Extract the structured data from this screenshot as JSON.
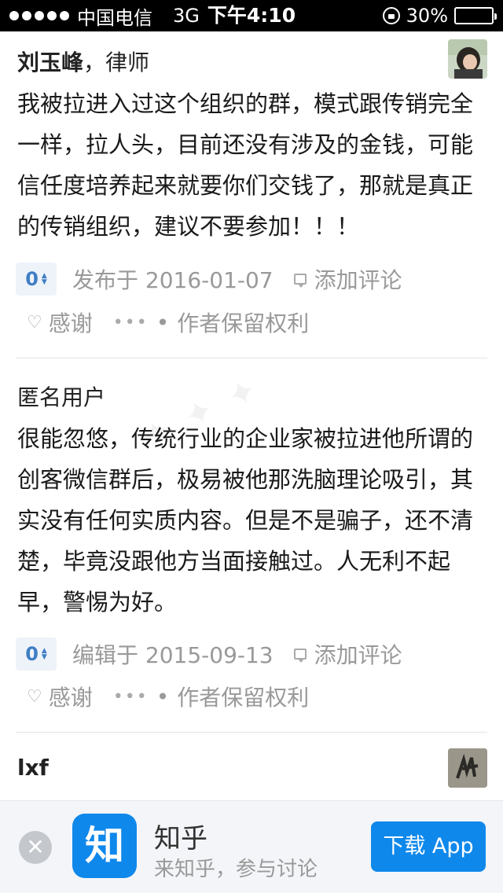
{
  "status_bar": {
    "carrier": "中国电信",
    "network": "3G",
    "time": "下午4:10",
    "battery_text": "30%",
    "battery_level": 0.3
  },
  "answers": [
    {
      "author_name": "刘玉峰",
      "author_title": "，律师",
      "content": "我被拉进入过这个组织的群，模式跟传销完全一样，拉人头，目前还没有涉及的金钱，可能信任度培养起来就要你们交钱了，那就是真正的传销组织，建议不要参加！！！",
      "votes": "0",
      "date_text": "发布于 2016-01-07",
      "comment_label": "添加评论",
      "thanks_label": "感谢",
      "more_label": "•••",
      "rights_label": "作者保留权利"
    },
    {
      "author_name": "匿名用户",
      "author_title": "",
      "content": "很能忽悠，传统行业的企业家被拉进他所谓的创客微信群后，极易被他那洗脑理论吸引，其实没有任何实质内容。但是不是骗子，还不清楚，毕竟没跟他方当面接触过。人无利不起早，警惕为好。",
      "votes": "0",
      "date_text": "编辑于 2015-09-13",
      "comment_label": "添加评论",
      "thanks_label": "感谢",
      "more_label": "•••",
      "rights_label": "作者保留权利"
    },
    {
      "author_name": "lxf",
      "author_title": ""
    }
  ],
  "banner": {
    "close_icon": "✕",
    "app_icon_text": "知",
    "app_name": "知乎",
    "app_subtitle": "来知乎，参与讨论",
    "download_label": "下载 App"
  }
}
